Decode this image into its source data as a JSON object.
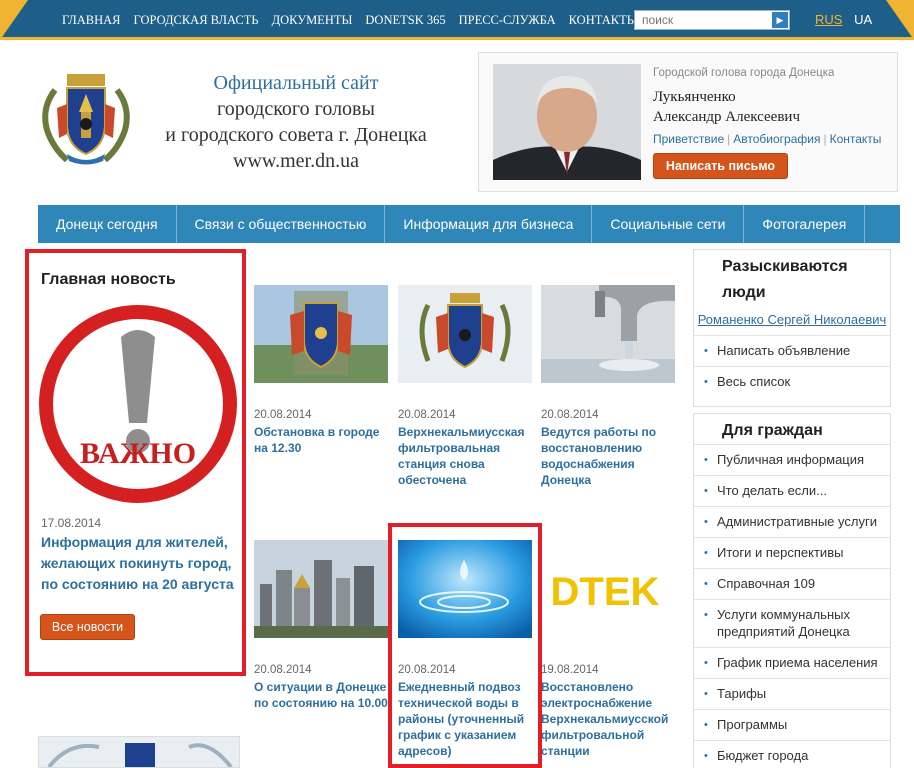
{
  "topnav": {
    "items": [
      "ГЛАВНАЯ",
      "ГОРОДСКАЯ ВЛАСТЬ",
      "ДОКУМЕНТЫ",
      "DONETSK 365",
      "ПРЕСС-СЛУЖБА",
      "КОНТАКТЫ"
    ],
    "search_placeholder": "поиск",
    "lang_ru": "RUS",
    "lang_ua": "UA"
  },
  "header": {
    "line1": "Официальный сайт",
    "line2": "городского головы",
    "line3": "и городского совета г. Донецка",
    "line4": "www.mer.dn.ua"
  },
  "mayor": {
    "role": "Городской голова города Донецка",
    "surname": "Лукьянченко",
    "given": "Александр Алексеевич",
    "link_greeting": "Приветствие",
    "link_bio": "Автобиография",
    "link_contacts": "Контакты",
    "write_btn": "Написать письмо"
  },
  "mainnav": [
    "Донецк сегодня",
    "Связи с общественностью",
    "Информация для бизнеса",
    "Социальные сети",
    "Фотогалерея"
  ],
  "feature": {
    "heading": "Главная новость",
    "image_text": "ВАЖНО",
    "date": "17.08.2014",
    "headline": "Информация для жителей, желающих покинуть город, по состоянию на 20 августа",
    "all_news": "Все новости"
  },
  "news": [
    {
      "date": "20.08.2014",
      "title": "Обстановка в городе на 12.30"
    },
    {
      "date": "20.08.2014",
      "title": "Верхнекальмиусская фильтровальная станция снова обесточена"
    },
    {
      "date": "20.08.2014",
      "title": "Ведутся работы по восстановлению водоснабжения Донецка"
    },
    {
      "date": "20.08.2014",
      "title": "О ситуации в Донецке по состоянию на 10.00"
    },
    {
      "date": "20.08.2014",
      "title": "Ежедневный подвоз технической воды в районы (уточненный график с указанием адресов)"
    },
    {
      "date": "19.08.2014",
      "title": "Восстановлено электроснабжение Верхнекальмиусской фильтровальной станции"
    }
  ],
  "dtek_logo": "DTEK",
  "wanted": {
    "title": "Разыскиваются люди",
    "person": "Романенко Сергей Николаевич",
    "items": [
      "Написать объявление",
      "Весь список"
    ]
  },
  "citizens": {
    "title": "Для граждан",
    "items": [
      "Публичная информация",
      "Что делать если...",
      "Административные услуги",
      "Итоги и перспективы",
      "Справочная 109",
      "Услуги коммунальных предприятий Донецка",
      "График приема населения",
      "Тарифы",
      "Программы",
      "Бюджет города"
    ]
  },
  "colors": {
    "brand_blue": "#2f86b8",
    "accent_red": "#e21e26",
    "button_orange": "#d4541c",
    "gold": "#f0b432"
  }
}
